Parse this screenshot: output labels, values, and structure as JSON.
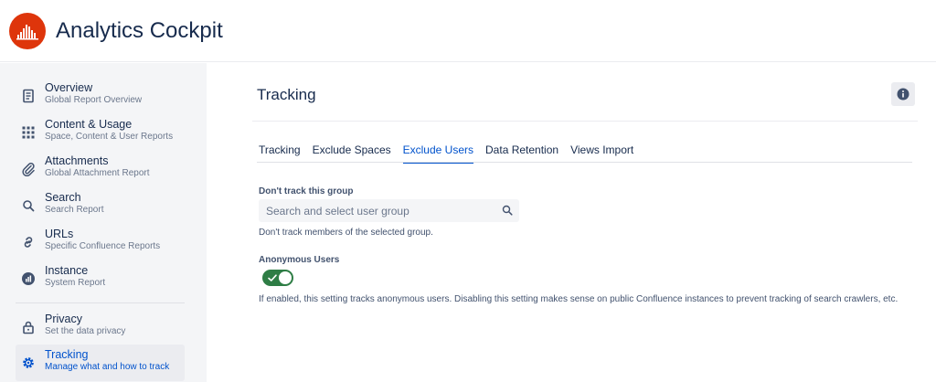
{
  "app": {
    "title": "Analytics Cockpit",
    "logo_icon": "analytics-logo-icon",
    "accent": "#de350b"
  },
  "sidebar": {
    "items": [
      {
        "label": "Overview",
        "sub": "Global Report Overview",
        "icon": "document-icon"
      },
      {
        "label": "Content & Usage",
        "sub": "Space, Content & User Reports",
        "icon": "grid-icon"
      },
      {
        "label": "Attachments",
        "sub": "Global Attachment Report",
        "icon": "paperclip-icon"
      },
      {
        "label": "Search",
        "sub": "Search Report",
        "icon": "search-icon"
      },
      {
        "label": "URLs",
        "sub": "Specific Confluence Reports",
        "icon": "link-icon"
      },
      {
        "label": "Instance",
        "sub": "System Report",
        "icon": "bar-chart-icon"
      },
      {
        "label": "Privacy",
        "sub": "Set the data privacy",
        "icon": "lock-icon"
      },
      {
        "label": "Tracking",
        "sub": "Manage what and how to track",
        "icon": "gear-icon",
        "active": true
      }
    ]
  },
  "main": {
    "title": "Tracking",
    "info_icon": "info-icon",
    "tabs": [
      {
        "label": "Tracking"
      },
      {
        "label": "Exclude Spaces"
      },
      {
        "label": "Exclude Users",
        "active": true
      },
      {
        "label": "Data Retention"
      },
      {
        "label": "Views Import"
      }
    ],
    "group": {
      "label": "Don't track this group",
      "placeholder": "Search and select user group",
      "value": "",
      "help": "Don't track members of the selected group."
    },
    "anonymous": {
      "label": "Anonymous Users",
      "enabled": true,
      "help": "If enabled, this setting tracks anonymous users. Disabling this setting makes sense on public Confluence instances to prevent tracking of search crawlers, etc."
    }
  },
  "colors": {
    "active": "#0052cc",
    "toggle_on": "#2e7d45",
    "sidebar_bg": "#f4f5f7"
  }
}
